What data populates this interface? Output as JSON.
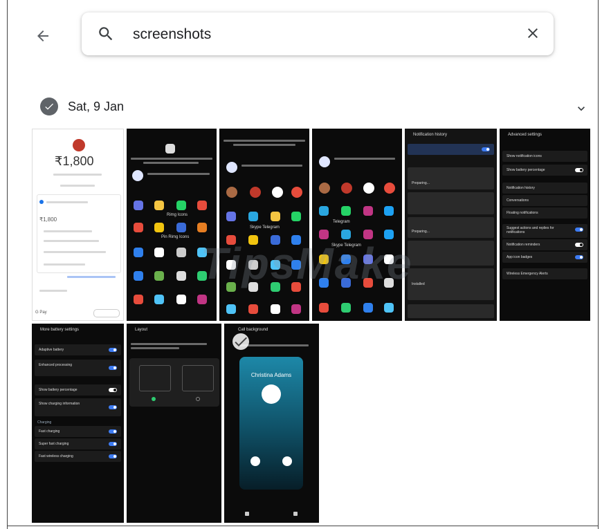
{
  "search": {
    "query": "screenshots",
    "back_icon": "arrow-back-icon",
    "search_icon": "search-icon",
    "clear_icon": "close-icon"
  },
  "group": {
    "date": "Sat, 9 Jan",
    "selected": true
  },
  "thumbnails": [
    {
      "kind": "payment",
      "amount": "₹1,800",
      "balance": "₹1,800",
      "footer": "G Pay"
    },
    {
      "kind": "share-sheet",
      "labels": [
        "Rimg Icons",
        "Pin Rimg Icons"
      ]
    },
    {
      "kind": "share-sheet",
      "labels": [
        "Skype Telegram"
      ]
    },
    {
      "kind": "share-sheet",
      "labels": [
        "Telegram",
        "Skype Telegram"
      ]
    },
    {
      "kind": "notification-history",
      "title": "Notification history",
      "rows": [
        "Preparing...",
        "Preparing...",
        "Installed"
      ]
    },
    {
      "kind": "advanced-settings",
      "title": "Advanced settings",
      "rows": [
        {
          "label": "Show notification icons",
          "toggle": null
        },
        {
          "label": "Show battery percentage",
          "toggle": "off"
        },
        {
          "label": "Notification history",
          "toggle": null
        },
        {
          "label": "Conversations",
          "toggle": null
        },
        {
          "label": "Floating notifications",
          "toggle": null
        },
        {
          "label": "Suggest actions and replies for notifications",
          "toggle": "on"
        },
        {
          "label": "Notification reminders",
          "toggle": "off"
        },
        {
          "label": "App icon badges",
          "toggle": "on"
        },
        {
          "label": "Wireless Emergency Alerts",
          "toggle": null
        }
      ]
    },
    {
      "kind": "battery-settings",
      "title": "More battery settings",
      "rows": [
        {
          "label": "Adaptive battery",
          "toggle": "on"
        },
        {
          "label": "Enhanced processing",
          "toggle": "on"
        },
        {
          "label": "Show battery percentage",
          "toggle": "off"
        },
        {
          "label": "Show charging information",
          "toggle": "on"
        },
        {
          "label": "Charging",
          "toggle": null
        },
        {
          "label": "Fast charging",
          "toggle": "on"
        },
        {
          "label": "Super fast charging",
          "toggle": "on"
        },
        {
          "label": "Fast wireless charging",
          "toggle": "on"
        }
      ]
    },
    {
      "kind": "layout",
      "title": "Layout"
    },
    {
      "kind": "call-background",
      "title": "Call background",
      "contact": "Christina Adams"
    }
  ],
  "watermark": "TipsMake",
  "colors": {
    "accent": "#3d7bf2",
    "check": "#5f6368",
    "text": "#202124"
  }
}
